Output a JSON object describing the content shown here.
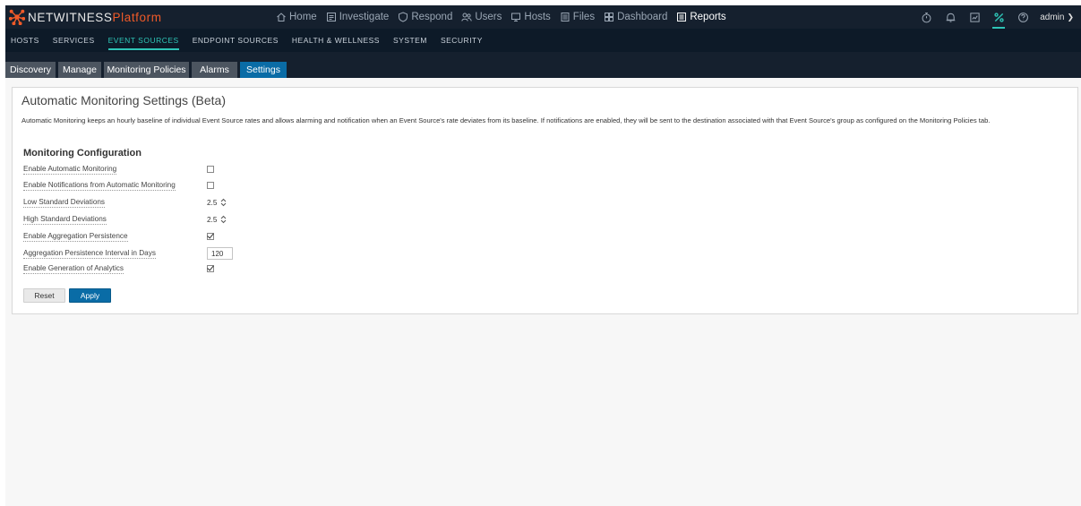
{
  "header": {
    "brand": "NETWITNESS",
    "brand_sub": "Platform",
    "nav": [
      {
        "label": "Home",
        "icon": "home-icon"
      },
      {
        "label": "Investigate",
        "icon": "investigate-icon"
      },
      {
        "label": "Respond",
        "icon": "shield-icon"
      },
      {
        "label": "Users",
        "icon": "users-icon"
      },
      {
        "label": "Hosts",
        "icon": "hosts-icon"
      },
      {
        "label": "Files",
        "icon": "file-icon"
      },
      {
        "label": "Dashboard",
        "icon": "dashboard-icon"
      },
      {
        "label": "Reports",
        "icon": "report-icon"
      }
    ],
    "active_nav": "Reports",
    "user": "admin"
  },
  "subnav": {
    "items": [
      "HOSTS",
      "SERVICES",
      "EVENT SOURCES",
      "ENDPOINT SOURCES",
      "HEALTH & WELLNESS",
      "SYSTEM",
      "SECURITY"
    ],
    "active": "EVENT SOURCES"
  },
  "tabs": {
    "items": [
      "Discovery",
      "Manage",
      "Monitoring Policies",
      "Alarms",
      "Settings"
    ],
    "active": "Settings"
  },
  "panel": {
    "title": "Automatic Monitoring Settings (Beta)",
    "description": "Automatic Monitoring keeps an hourly baseline of individual Event Source rates and allows alarming and notification when an Event Source's rate deviates from its baseline. If notifications are enabled, they will be sent to the destination associated with that Event Source's group as configured on the Monitoring Policies tab.",
    "section_title": "Monitoring Configuration",
    "settings": [
      {
        "label": "Enable Automatic Monitoring",
        "type": "checkbox",
        "value": false
      },
      {
        "label": "Enable Notifications from Automatic Monitoring",
        "type": "checkbox",
        "value": false
      },
      {
        "label": "Low Standard Deviations",
        "type": "spinner",
        "value": "2.5"
      },
      {
        "label": "High Standard Deviations",
        "type": "spinner",
        "value": "2.5"
      },
      {
        "label": "Enable Aggregation Persistence",
        "type": "checkbox",
        "value": true
      },
      {
        "label": "Aggregation Persistence Interval in Days",
        "type": "text",
        "value": "120"
      },
      {
        "label": "Enable Generation of Analytics",
        "type": "checkbox",
        "value": true
      }
    ],
    "reset_label": "Reset",
    "apply_label": "Apply"
  },
  "colors": {
    "topbar": "#15202e",
    "accent": "#2ec4b6",
    "brand_orange": "#f05a28",
    "primary_button": "#0a6ca6"
  }
}
